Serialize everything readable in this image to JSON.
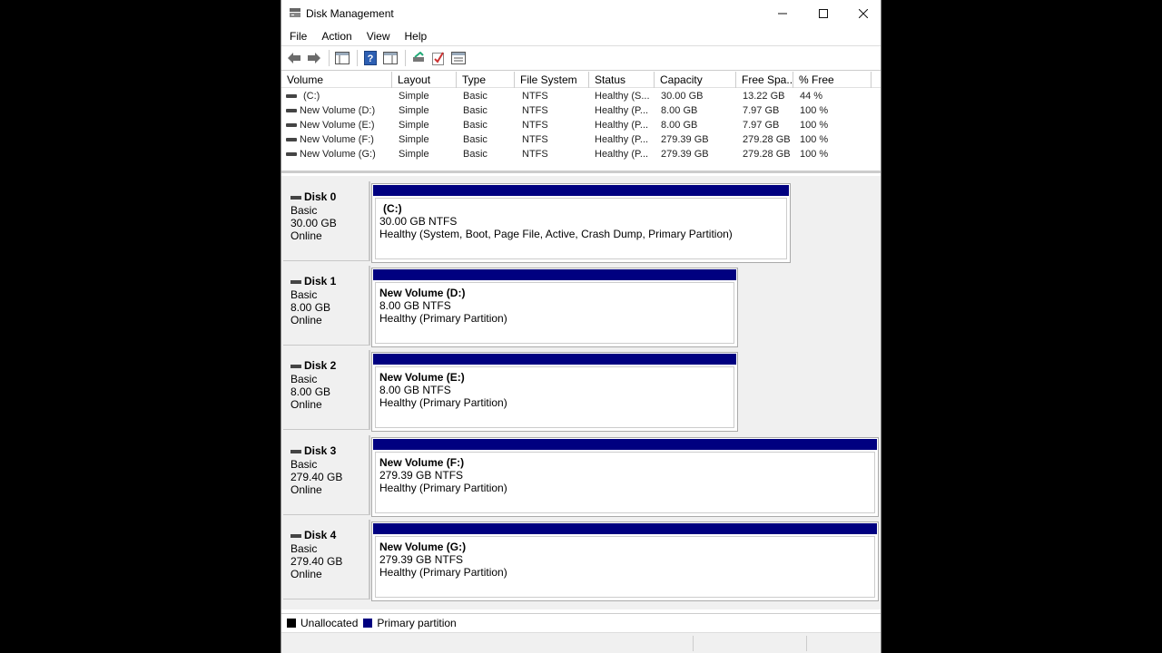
{
  "window": {
    "title": "Disk Management"
  },
  "menu": [
    "File",
    "Action",
    "View",
    "Help"
  ],
  "toolbar": {
    "icons": [
      "back-arrow-icon",
      "forward-arrow-icon",
      "console-tree-icon",
      "help-icon",
      "properties-icon",
      "connect-disk-icon",
      "check-icon",
      "list-view-icon"
    ]
  },
  "volume_list": {
    "columns": [
      "Volume",
      "Layout",
      "Type",
      "File System",
      "Status",
      "Capacity",
      "Free Spa...",
      "% Free"
    ],
    "rows": [
      [
        "(C:)",
        "Simple",
        "Basic",
        "NTFS",
        "Healthy (S...",
        "30.00 GB",
        "13.22 GB",
        "44 %"
      ],
      [
        "New Volume (D:)",
        "Simple",
        "Basic",
        "NTFS",
        "Healthy (P...",
        "8.00 GB",
        "7.97 GB",
        "100 %"
      ],
      [
        "New Volume (E:)",
        "Simple",
        "Basic",
        "NTFS",
        "Healthy (P...",
        "8.00 GB",
        "7.97 GB",
        "100 %"
      ],
      [
        "New Volume (F:)",
        "Simple",
        "Basic",
        "NTFS",
        "Healthy (P...",
        "279.39 GB",
        "279.28 GB",
        "100 %"
      ],
      [
        "New Volume (G:)",
        "Simple",
        "Basic",
        "NTFS",
        "Healthy (P...",
        "279.39 GB",
        "279.28 GB",
        "100 %"
      ]
    ]
  },
  "disks": [
    {
      "name": "Disk 0",
      "type": "Basic",
      "size": "30.00 GB",
      "state": "Online",
      "partition": {
        "name": "(C:)",
        "size_fs": "30.00 GB NTFS",
        "status": "Healthy (System, Boot, Page File, Active, Crash Dump, Primary Partition)"
      }
    },
    {
      "name": "Disk 1",
      "type": "Basic",
      "size": "8.00 GB",
      "state": "Online",
      "partition": {
        "name": "New Volume  (D:)",
        "size_fs": "8.00 GB NTFS",
        "status": "Healthy (Primary Partition)"
      }
    },
    {
      "name": "Disk 2",
      "type": "Basic",
      "size": "8.00 GB",
      "state": "Online",
      "partition": {
        "name": "New Volume  (E:)",
        "size_fs": "8.00 GB NTFS",
        "status": "Healthy (Primary Partition)"
      }
    },
    {
      "name": "Disk 3",
      "type": "Basic",
      "size": "279.40 GB",
      "state": "Online",
      "partition": {
        "name": "New Volume  (F:)",
        "size_fs": "279.39 GB NTFS",
        "status": "Healthy (Primary Partition)"
      }
    },
    {
      "name": "Disk 4",
      "type": "Basic",
      "size": "279.40 GB",
      "state": "Online",
      "partition": {
        "name": "New Volume  (G:)",
        "size_fs": "279.39 GB NTFS",
        "status": "Healthy (Primary Partition)"
      }
    }
  ],
  "legend": [
    {
      "label": "Unallocated",
      "color": "#000000"
    },
    {
      "label": "Primary partition",
      "color": "#000080"
    }
  ],
  "colors": {
    "primary_partition": "#000080",
    "unallocated": "#000000"
  }
}
